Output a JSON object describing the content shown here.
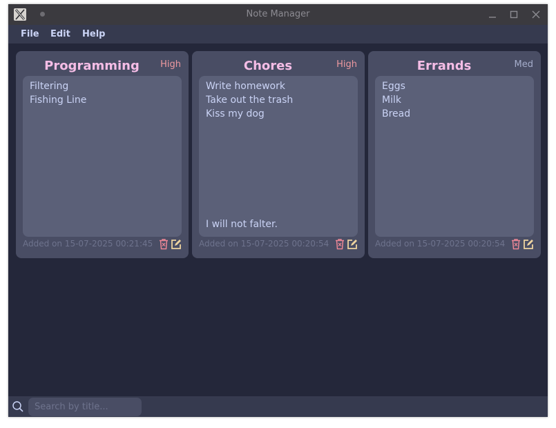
{
  "window": {
    "title": "Note Manager"
  },
  "menu": {
    "file": "File",
    "edit": "Edit",
    "help": "Help"
  },
  "notes": [
    {
      "title": "Programming",
      "priority": "High",
      "priority_color": "#ee99a0",
      "lines": [
        "Filtering",
        "Fishing Line"
      ],
      "footer_line": "",
      "date": "Added on 15-07-2025 00:21:45"
    },
    {
      "title": "Chores",
      "priority": "High",
      "priority_color": "#ee99a0",
      "lines": [
        "Write homework",
        "Take out the trash",
        "Kiss my dog"
      ],
      "footer_line": "I will not falter.",
      "date": "Added on 15-07-2025 00:20:54"
    },
    {
      "title": "Errands",
      "priority": "Med",
      "priority_color": "#a5adcb",
      "lines": [
        "Eggs",
        "Milk",
        "Bread"
      ],
      "footer_line": "",
      "date": "Added on 15-07-2025 00:20:54"
    }
  ],
  "search": {
    "placeholder": "Search by title..."
  },
  "colors": {
    "background": "#24273a",
    "card": "#494d64",
    "note_body": "#5b6078",
    "title_accent": "#f5bde6",
    "delete_icon": "#ed8796",
    "edit_icon": "#eed49f"
  },
  "icons": {
    "app": "app-icon",
    "delete": "trash-icon",
    "edit": "edit-icon",
    "search": "search-icon"
  }
}
